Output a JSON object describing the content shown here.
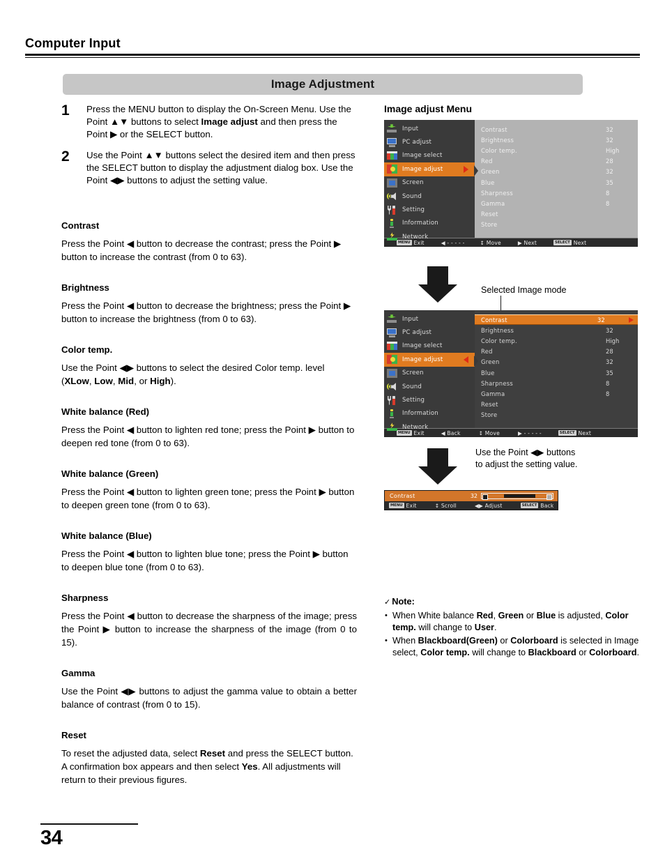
{
  "header": {
    "chapter": "Computer Input",
    "section_title": "Image Adjustment"
  },
  "steps": [
    {
      "num": "1",
      "parts": [
        {
          "t": "Press the MENU button to display the On-Screen Menu. Use the Point ▲▼ buttons to select ",
          "b": false
        },
        {
          "t": "Image adjust",
          "b": true
        },
        {
          "t": " and then press the Point ▶ or the SELECT button.",
          "b": false
        }
      ]
    },
    {
      "num": "2",
      "parts": [
        {
          "t": "Use the Point ▲▼ buttons select the desired item and then press the SELECT button to display the adjustment dialog box. Use the Point ◀▶ buttons to adjust the setting value.",
          "b": false
        }
      ]
    }
  ],
  "sections": [
    {
      "heading": "Contrast",
      "parts": [
        {
          "t": "Press the Point ◀ button to decrease the contrast; press the Point ▶ button to increase the contrast (from 0 to 63).",
          "b": false
        }
      ],
      "justify": false
    },
    {
      "heading": "Brightness",
      "parts": [
        {
          "t": "Press the Point ◀ button to decrease the brightness; press the Point ▶ button to increase the brightness (from 0 to 63).",
          "b": false
        }
      ],
      "justify": false
    },
    {
      "heading": "Color temp.",
      "parts": [
        {
          "t": "Use the Point ◀▶ buttons to select the desired Color temp. level (",
          "b": false
        },
        {
          "t": "XLow",
          "b": true
        },
        {
          "t": ", ",
          "b": false
        },
        {
          "t": "Low",
          "b": true
        },
        {
          "t": ", ",
          "b": false
        },
        {
          "t": "Mid",
          "b": true
        },
        {
          "t": ", or ",
          "b": false
        },
        {
          "t": "High",
          "b": true
        },
        {
          "t": ").",
          "b": false
        }
      ],
      "justify": false
    },
    {
      "heading": "White balance (Red)",
      "parts": [
        {
          "t": "Press the Point ◀ button to lighten red tone; press the Point ▶ button to deepen red tone (from 0 to 63).",
          "b": false
        }
      ],
      "justify": false
    },
    {
      "heading": "White balance (Green)",
      "parts": [
        {
          "t": "Press the Point ◀ button to lighten green tone; press the Point ▶ button to deepen green tone (from 0 to 63).",
          "b": false
        }
      ],
      "justify": false
    },
    {
      "heading": "White balance (Blue)",
      "parts": [
        {
          "t": "Press the Point ◀ button to lighten blue tone; press the Point ▶ button to deepen blue tone (from 0 to 63).",
          "b": false
        }
      ],
      "justify": false
    },
    {
      "heading": "Sharpness",
      "parts": [
        {
          "t": "Press the Point ◀ button to decrease the sharpness of the image; press the Point ▶ button to increase the sharpness of the image (from 0 to 15).",
          "b": false
        }
      ],
      "justify": true
    },
    {
      "heading": "Gamma",
      "parts": [
        {
          "t": "Use the Point ◀▶ buttons to adjust the gamma value to obtain a better balance of contrast (from 0 to 15).",
          "b": false
        }
      ],
      "justify": true
    },
    {
      "heading": "Reset",
      "parts": [
        {
          "t": "To reset the adjusted data, select ",
          "b": false
        },
        {
          "t": "Reset",
          "b": true
        },
        {
          "t": " and press the SELECT button. A confirmation box appears and then select ",
          "b": false
        },
        {
          "t": "Yes",
          "b": true
        },
        {
          "t": ". All adjustments will return to their previous figures.",
          "b": false
        }
      ],
      "justify": false
    }
  ],
  "right": {
    "menu_title": "Image adjust Menu",
    "callout_selected_mode": "Selected Image mode",
    "callout_adjust": "Use the Point ◀▶ buttons to adjust the setting value."
  },
  "osd": {
    "sidebar": [
      {
        "label": "Input",
        "icon": "input-icon"
      },
      {
        "label": "PC adjust",
        "icon": "monitor-icon"
      },
      {
        "label": "Image select",
        "icon": "image-select-icon"
      },
      {
        "label": "Image adjust",
        "icon": "image-adjust-icon"
      },
      {
        "label": "Screen",
        "icon": "screen-icon"
      },
      {
        "label": "Sound",
        "icon": "sound-icon"
      },
      {
        "label": "Setting",
        "icon": "setting-icon"
      },
      {
        "label": "Information",
        "icon": "information-icon"
      },
      {
        "label": "Network",
        "icon": "network-icon"
      }
    ],
    "active_index": 3,
    "rows": [
      {
        "name": "Contrast",
        "value": "32"
      },
      {
        "name": "Brightness",
        "value": "32"
      },
      {
        "name": "Color temp.",
        "value": "High"
      },
      {
        "name": "Red",
        "value": "28"
      },
      {
        "name": "Green",
        "value": "32"
      },
      {
        "name": "Blue",
        "value": "35"
      },
      {
        "name": "Sharpness",
        "value": "8"
      },
      {
        "name": "Gamma",
        "value": "8"
      },
      {
        "name": "Reset",
        "value": ""
      },
      {
        "name": "Store",
        "value": ""
      }
    ],
    "selected_row_index": 0,
    "footer_top": [
      {
        "key": "MENU",
        "label": "Exit"
      },
      {
        "key": "",
        "label": "◀ - - - - -"
      },
      {
        "key": "",
        "label": "↕ Move"
      },
      {
        "key": "",
        "label": "▶ Next"
      },
      {
        "key": "SELECT",
        "label": "Next"
      }
    ],
    "footer_bottom": [
      {
        "key": "MENU",
        "label": "Exit"
      },
      {
        "key": "",
        "label": "◀ Back"
      },
      {
        "key": "",
        "label": "↕ Move"
      },
      {
        "key": "",
        "label": "▶ - - - - -"
      },
      {
        "key": "SELECT",
        "label": "Next"
      }
    ]
  },
  "dialog": {
    "label": "Contrast",
    "value": "32",
    "footer": [
      {
        "key": "MENU",
        "label": "Exit"
      },
      {
        "key": "",
        "label": "↕ Scroll"
      },
      {
        "key": "",
        "label": "◀▶ Adjust"
      },
      {
        "key": "SELECT",
        "label": "Back"
      }
    ]
  },
  "note": {
    "check": "✓",
    "title": "Note:",
    "items": [
      [
        {
          "t": "When White balance ",
          "b": false
        },
        {
          "t": "Red",
          "b": true
        },
        {
          "t": ", ",
          "b": false
        },
        {
          "t": "Green",
          "b": true
        },
        {
          "t": " or ",
          "b": false
        },
        {
          "t": "Blue",
          "b": true
        },
        {
          "t": " is adjusted, ",
          "b": false
        },
        {
          "t": "Color temp.",
          "b": true
        },
        {
          "t": " will change to ",
          "b": false
        },
        {
          "t": "User",
          "b": true
        },
        {
          "t": ".",
          "b": false
        }
      ],
      [
        {
          "t": "When ",
          "b": false
        },
        {
          "t": "Blackboard(Green)",
          "b": true
        },
        {
          "t": " or ",
          "b": false
        },
        {
          "t": "Colorboard",
          "b": true
        },
        {
          "t": " is selected in Image select, ",
          "b": false
        },
        {
          "t": "Color temp.",
          "b": true
        },
        {
          "t": " will change to ",
          "b": false
        },
        {
          "t": "Blackboard",
          "b": true
        },
        {
          "t": " or ",
          "b": false
        },
        {
          "t": "Colorboard",
          "b": true
        },
        {
          "t": ".",
          "b": false
        }
      ]
    ]
  },
  "footer": {
    "page_number": "34"
  },
  "colors": {
    "accent_orange": "#e07b20",
    "banner_gray": "#c6c6c6",
    "osd_dark": "#3a3a3a",
    "osd_dim": "#b3b3b3",
    "arrow_red": "#e02b16"
  }
}
